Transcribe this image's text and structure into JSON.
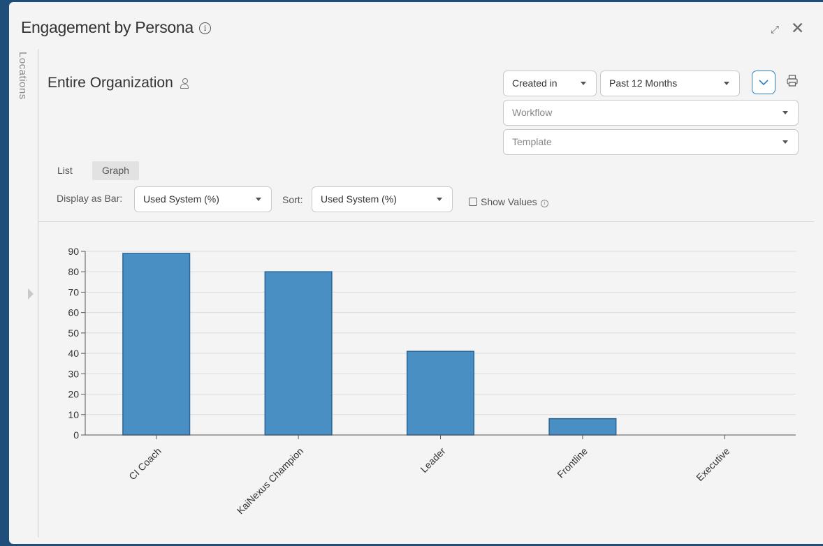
{
  "window": {
    "title": "Engagement by Persona",
    "info_icon": "info-icon",
    "expand_icon": "expand-icon",
    "close_icon": "close-icon"
  },
  "sidebar": {
    "label": "Locations"
  },
  "header": {
    "org_title": "Entire Organization",
    "org_icon": "person-icon"
  },
  "filters": {
    "date_field": "Created in",
    "date_range": "Past 12 Months",
    "workflow_placeholder": "Workflow",
    "template_placeholder": "Template"
  },
  "view_tabs": {
    "list": "List",
    "graph": "Graph",
    "active": "Graph"
  },
  "controls": {
    "display_label": "Display as Bar:",
    "display_value": "Used System (%)",
    "sort_label": "Sort:",
    "sort_value": "Used System (%)",
    "show_values_label": "Show Values",
    "show_values_checked": false
  },
  "chart_data": {
    "type": "bar",
    "categories": [
      "CI Coach",
      "KaiNexus Champion",
      "Leader",
      "Frontline",
      "Executive"
    ],
    "values": [
      89,
      80,
      41,
      8,
      0
    ],
    "ylim": [
      0,
      90
    ],
    "yticks": [
      0,
      10,
      20,
      30,
      40,
      50,
      60,
      70,
      80,
      90
    ],
    "grid": true,
    "bar_color": "#4a8fc4",
    "bar_border": "#2a6596"
  },
  "colors": {
    "background": "#1e4e79",
    "panel": "#f4f4f4",
    "accent": "#2f7fbf"
  }
}
